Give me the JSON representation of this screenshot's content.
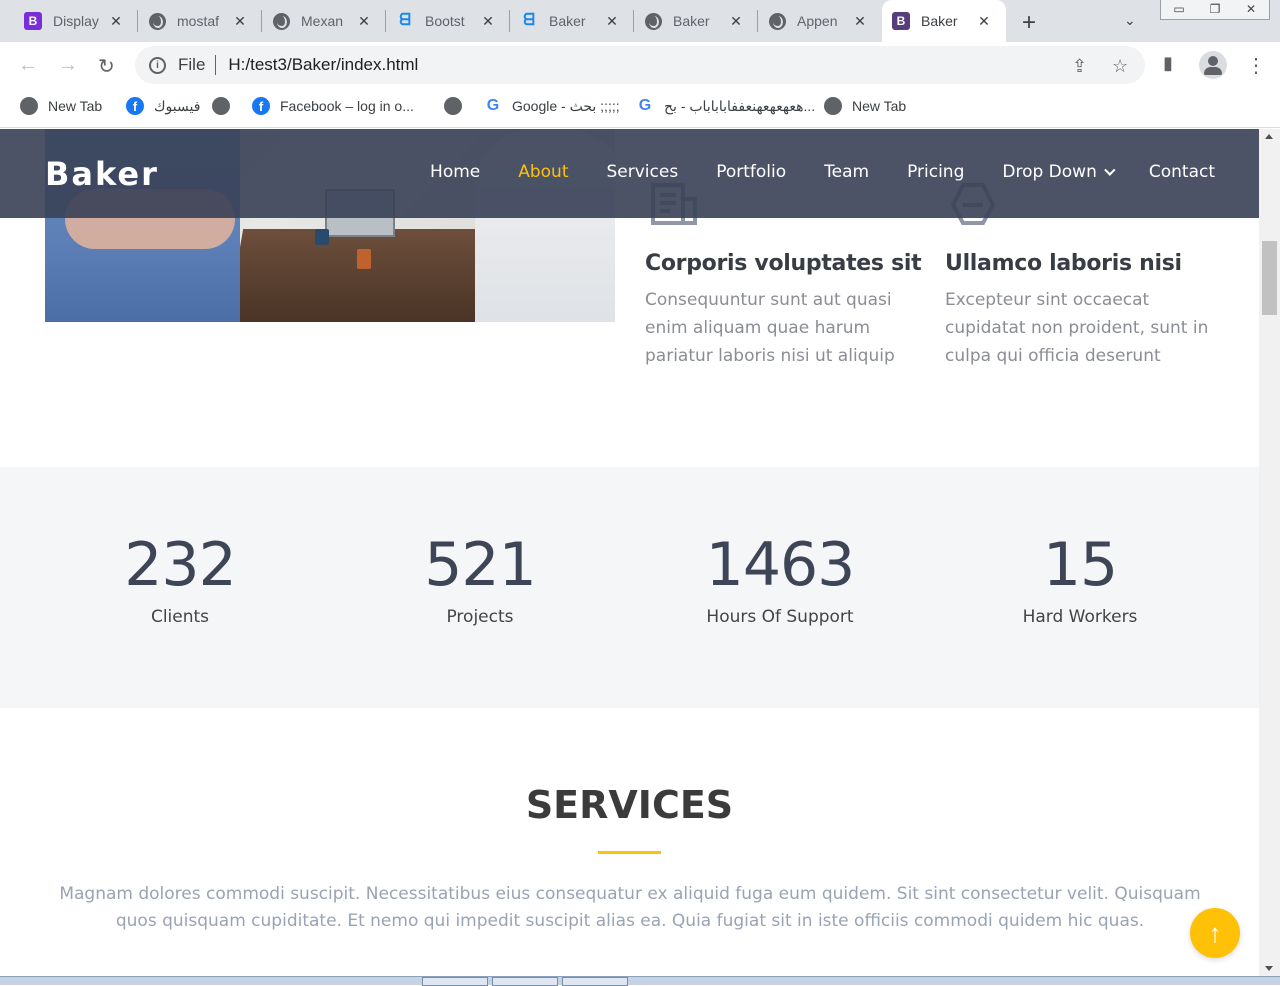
{
  "browser": {
    "tabs": [
      {
        "title": "Display",
        "icon": "bootstrap-icon"
      },
      {
        "title": "mostaf",
        "icon": "globe-icon"
      },
      {
        "title": "Mexan",
        "icon": "globe-icon"
      },
      {
        "title": "Bootst",
        "icon": "bootstrap-studio-icon"
      },
      {
        "title": "Baker",
        "icon": "bootstrap-studio-icon"
      },
      {
        "title": "Baker",
        "icon": "globe-icon"
      },
      {
        "title": "Appen",
        "icon": "globe-icon"
      },
      {
        "title": "Baker",
        "icon": "bootstrap-icon"
      }
    ],
    "address": {
      "scheme": "File",
      "url": "H:/test3/Baker/index.html"
    },
    "bookmarks": [
      {
        "label": "New Tab",
        "icon": "globe-icon"
      },
      {
        "label": "فيسبوك",
        "icon": "facebook-icon"
      },
      {
        "label": "",
        "icon": "globe-icon"
      },
      {
        "label": "Facebook – log in o...",
        "icon": "facebook-icon"
      },
      {
        "label": "",
        "icon": "globe-icon"
      },
      {
        "label": "Google - بحث ;;;;;",
        "icon": "google-icon"
      },
      {
        "label": "هعهعهعهنعففاباباباب - بح...",
        "icon": "google-icon"
      },
      {
        "label": "New Tab",
        "icon": "globe-icon"
      }
    ]
  },
  "site": {
    "logo": "Baker",
    "nav": [
      "Home",
      "About",
      "Services",
      "Portfolio",
      "Team",
      "Pricing",
      "Drop Down",
      "Contact"
    ],
    "active_nav": "About",
    "accent_color": "#ffc107",
    "header_color": "#384056"
  },
  "about": {
    "features": [
      {
        "title": "Corporis voluptates sit",
        "text": "Consequuntur sunt aut quasi enim aliquam quae harum pariatur laboris nisi ut aliquip",
        "icon": "receipt-icon"
      },
      {
        "title": "Ullamco laboris nisi",
        "text": "Excepteur sint occaecat cupidatat non proident, sunt in culpa qui officia deserunt",
        "icon": "cube-icon"
      }
    ]
  },
  "counts": [
    {
      "value": "232",
      "label": "Clients"
    },
    {
      "value": "521",
      "label": "Projects"
    },
    {
      "value": "1463",
      "label": "Hours Of Support"
    },
    {
      "value": "15",
      "label": "Hard Workers"
    }
  ],
  "services": {
    "title": "SERVICES",
    "description": "Magnam dolores commodi suscipit. Necessitatibus eius consequatur ex aliquid fuga eum quidem. Sit sint consectetur velit. Quisquam quos quisquam cupiditate. Et nemo qui impedit suscipit alias ea. Quia fugiat sit in iste officiis commodi quidem hic quas."
  }
}
